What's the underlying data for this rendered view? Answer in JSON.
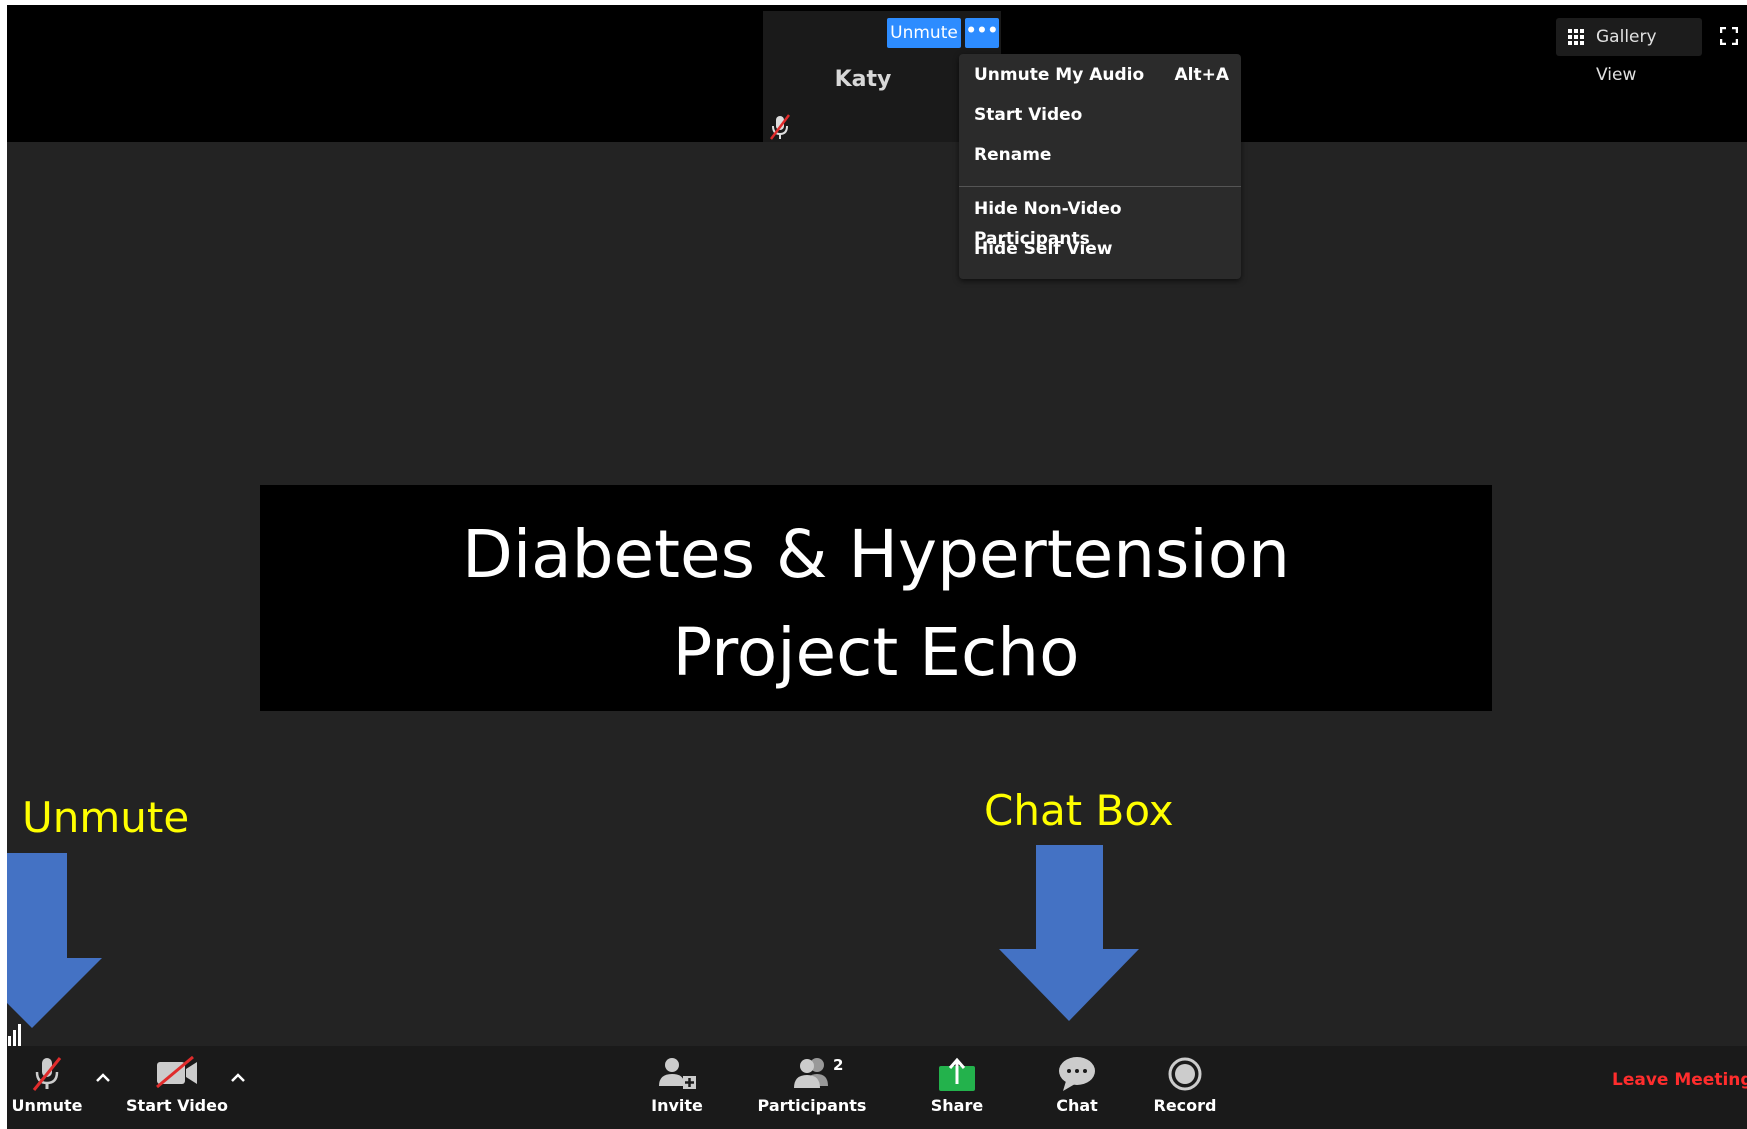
{
  "self_tile": {
    "name": "Katy",
    "unmute_label": "Unmute",
    "more_label": "•••"
  },
  "context_menu": {
    "items": [
      {
        "label": "Unmute My Audio",
        "shortcut": "Alt+A"
      },
      {
        "label": "Start Video"
      },
      {
        "label": "Rename"
      },
      {
        "label": "Hide Non-Video Participants"
      },
      {
        "label": "Hide Self View"
      }
    ]
  },
  "view_controls": {
    "gallery_view_label": "Gallery View"
  },
  "shared_content": {
    "line1": "Diabetes & Hypertension",
    "line2": "Project Echo"
  },
  "annotations": {
    "unmute_callout": "Unmute",
    "chat_callout": "Chat Box",
    "arrow_color": "#4472c4",
    "callout_color": "#ffff00"
  },
  "toolbar": {
    "unmute_label": "Unmute",
    "start_video_label": "Start Video",
    "invite_label": "Invite",
    "participants_label": "Participants",
    "participants_count": "2",
    "share_label": "Share",
    "chat_label": "Chat",
    "record_label": "Record",
    "leave_label": "Leave Meeting",
    "share_color": "#23b24c",
    "leave_color": "#ff2d2d"
  }
}
